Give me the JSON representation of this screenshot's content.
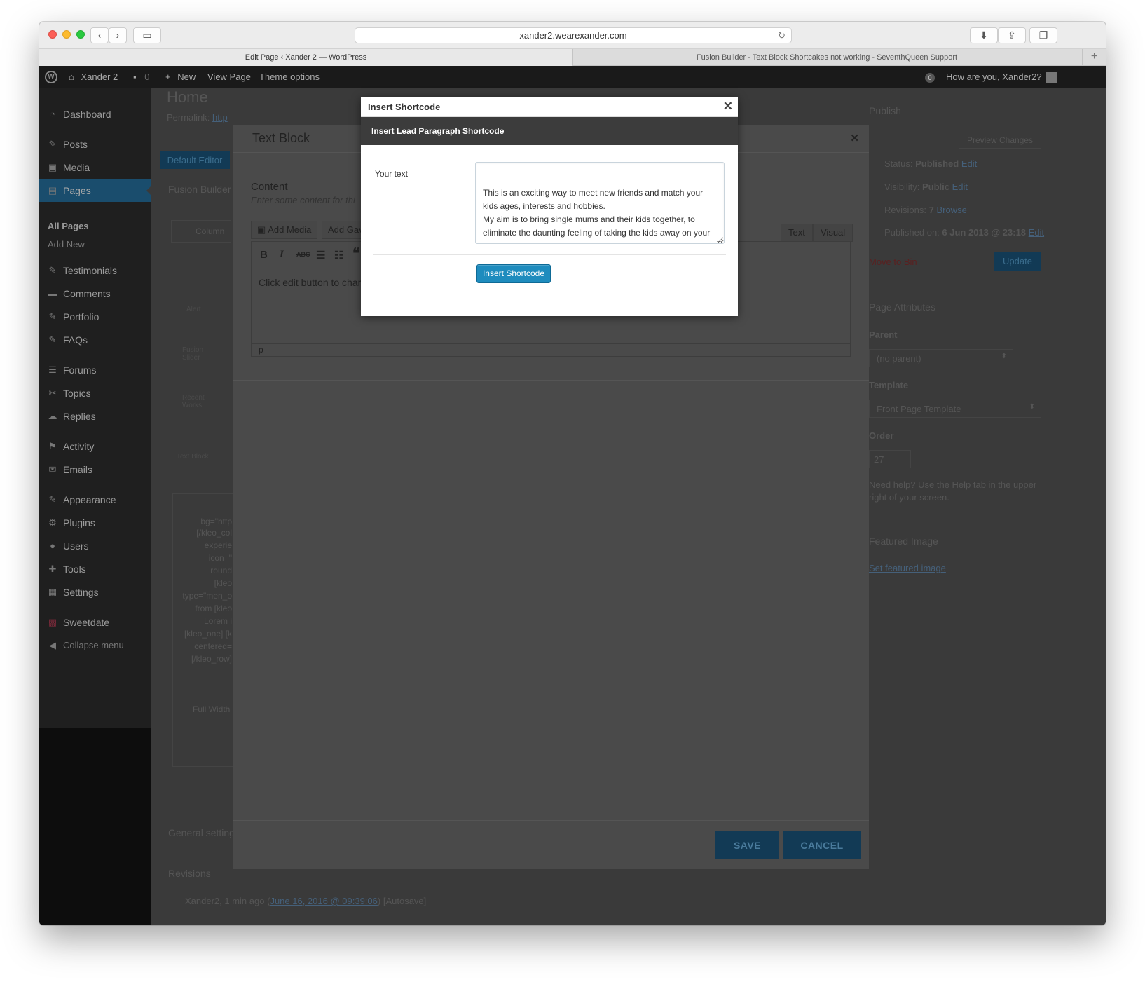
{
  "browser": {
    "url": "xander2.wearexander.com",
    "tabs": [
      {
        "label": "Edit Page ‹ Xander 2 — WordPress"
      },
      {
        "label": "Fusion Builder - Text Block Shortcakes not working - SeventhQueen Support"
      }
    ]
  },
  "adminbar": {
    "site_name": "Xander 2",
    "comments_count": "0",
    "new_label": "New",
    "view_page_label": "View Page",
    "theme_options_label": "Theme options",
    "notif_count": "0",
    "greeting": "How are you, Xander2?"
  },
  "sidebar": {
    "items": [
      {
        "label": "Dashboard"
      },
      {
        "label": "Posts"
      },
      {
        "label": "Media"
      },
      {
        "label": "Pages"
      },
      {
        "label": "Testimonials"
      },
      {
        "label": "Comments"
      },
      {
        "label": "Portfolio"
      },
      {
        "label": "FAQs"
      },
      {
        "label": "Forums"
      },
      {
        "label": "Topics"
      },
      {
        "label": "Replies"
      },
      {
        "label": "Activity"
      },
      {
        "label": "Emails"
      },
      {
        "label": "Appearance"
      },
      {
        "label": "Plugins"
      },
      {
        "label": "Users"
      },
      {
        "label": "Tools"
      },
      {
        "label": "Settings"
      },
      {
        "label": "Sweetdate"
      },
      {
        "label": "Collapse menu"
      }
    ],
    "sub_all_pages": "All Pages",
    "sub_add_new": "Add New"
  },
  "page": {
    "title": "Home",
    "permalink_label": "Permalink:",
    "permalink_link": "http",
    "default_editor": "Default Editor",
    "fusion_builder": "Fusion Builder",
    "column": "Column",
    "bg_items": [
      "Alert",
      "Fusion Slider",
      "Recent Works",
      "Text Block"
    ],
    "code_lines": [
      "bg=\"http",
      "[/kleo_col",
      "experie",
      "icon=\"",
      "round",
      "[kleo",
      "type=\"men_o",
      "from [kleo",
      "Lorem i",
      "[kleo_one] [k",
      "centered=",
      "[/kleo_row]"
    ],
    "full_width": "Full Width",
    "general_settings": "General setting",
    "revisions": "Revisions",
    "revision_author": "Xander2, 1 min ago",
    "revision_date": "June 16, 2016 @ 09:39:06",
    "revision_tag": "[Autosave]"
  },
  "publish": {
    "title": "Publish",
    "preview_changes": "Preview Changes",
    "status_label": "Status:",
    "status_value": "Published",
    "visibility_label": "Visibility:",
    "visibility_value": "Public",
    "revisions_label": "Revisions:",
    "revisions_value": "7",
    "browse": "Browse",
    "published_on_label": "Published on:",
    "published_on_value": "6 Jun 2013 @ 23:18",
    "edit": "Edit",
    "move_to_bin": "Move to Bin",
    "update": "Update"
  },
  "attributes": {
    "title": "Page Attributes",
    "parent_label": "Parent",
    "parent_value": "(no parent)",
    "template_label": "Template",
    "template_value": "Front Page Template",
    "order_label": "Order",
    "order_value": "27",
    "help_text_1": "Need help? Use the Help tab in the upper",
    "help_text_2": "right of your screen."
  },
  "featured": {
    "title": "Featured Image",
    "set_link": "Set featured image"
  },
  "fusion_modal": {
    "title": "Text Block",
    "content_label": "Content",
    "content_desc": "Enter some content for thi",
    "add_media": "Add Media",
    "add_gallery": "Add Gav",
    "tab_text": "Text",
    "tab_visual": "Visual",
    "editor_text": "Click edit button to char",
    "editor_path": "p",
    "save": "SAVE",
    "cancel": "CANCEL"
  },
  "dialog": {
    "title": "Insert Shortcode",
    "subtitle": "Insert Lead Paragraph Shortcode",
    "field_label": "Your text",
    "field_value": "This is an exciting way to meet new friends and match your kids ages, interests and hobbies.\nMy aim is to bring single mums and their kids together, to eliminate the daunting feeling of taking the kids away on your own.",
    "insert_button": "Insert Shortcode"
  }
}
